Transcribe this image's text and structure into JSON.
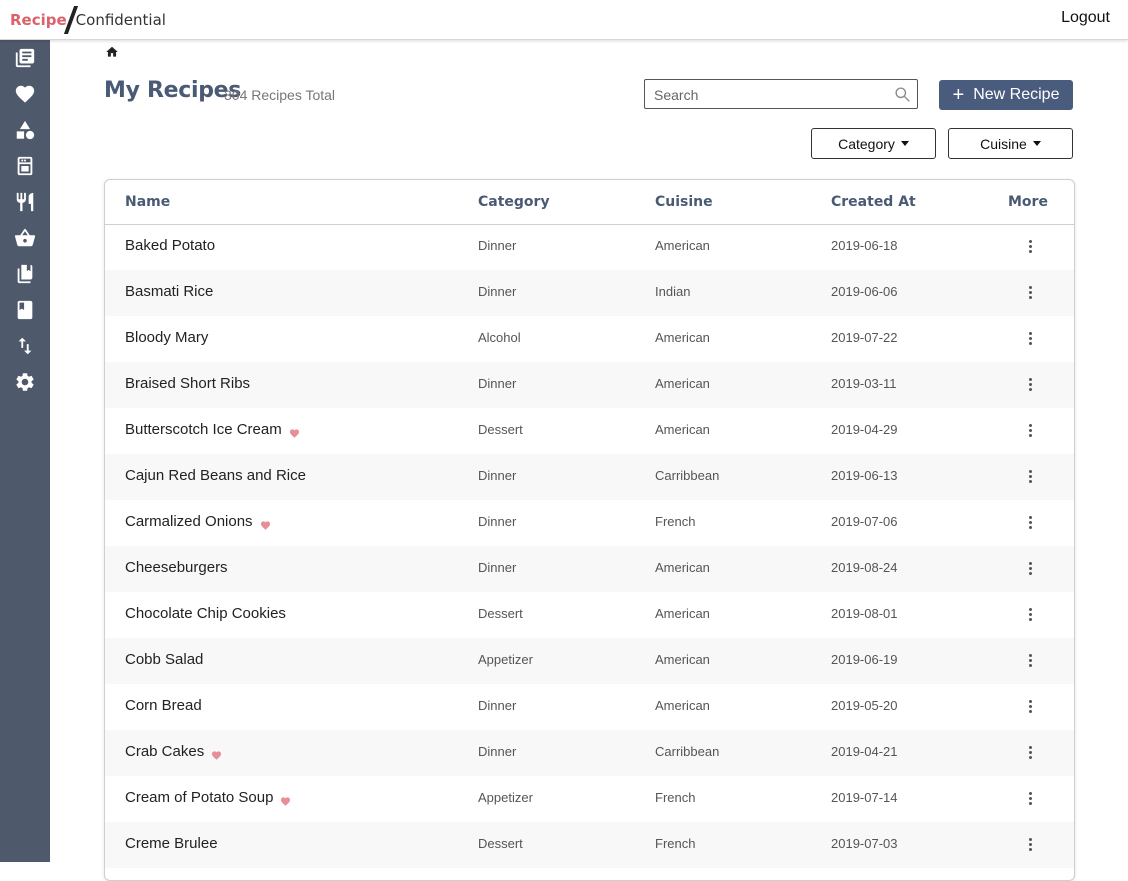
{
  "app": {
    "logo_part1": "Recipe",
    "logo_part2": "Confidential",
    "logout_label": "Logout"
  },
  "sidebar": {
    "icons": [
      "recipes-list-icon",
      "favorites-heart-icon",
      "categories-shapes-icon",
      "appliance-icon",
      "utensils-icon",
      "grocery-basket-icon",
      "cookbooks-icon",
      "book-icon",
      "import-export-icon",
      "settings-gear-icon"
    ]
  },
  "page": {
    "title": "My Recipes",
    "subtitle": "304 Recipes Total"
  },
  "search": {
    "placeholder": "Search",
    "value": ""
  },
  "new_recipe_label": "New Recipe",
  "filters": {
    "category_label": "Category",
    "cuisine_label": "Cuisine"
  },
  "table": {
    "headers": {
      "name": "Name",
      "category": "Category",
      "cuisine": "Cuisine",
      "created_at": "Created At",
      "more": "More"
    },
    "rows": [
      {
        "name": "Baked Potato",
        "favorite": false,
        "category": "Dinner",
        "cuisine": "American",
        "created_at": "2019-06-18"
      },
      {
        "name": "Basmati Rice",
        "favorite": false,
        "category": "Dinner",
        "cuisine": "Indian",
        "created_at": "2019-06-06"
      },
      {
        "name": "Bloody Mary",
        "favorite": false,
        "category": "Alcohol",
        "cuisine": "American",
        "created_at": "2019-07-22"
      },
      {
        "name": "Braised Short Ribs",
        "favorite": false,
        "category": "Dinner",
        "cuisine": "American",
        "created_at": "2019-03-11"
      },
      {
        "name": "Butterscotch Ice Cream",
        "favorite": true,
        "category": "Dessert",
        "cuisine": "American",
        "created_at": "2019-04-29"
      },
      {
        "name": "Cajun Red Beans and Rice",
        "favorite": false,
        "category": "Dinner",
        "cuisine": "Carribbean",
        "created_at": "2019-06-13"
      },
      {
        "name": "Carmalized Onions",
        "favorite": true,
        "category": "Dinner",
        "cuisine": "French",
        "created_at": "2019-07-06"
      },
      {
        "name": "Cheeseburgers",
        "favorite": false,
        "category": "Dinner",
        "cuisine": "American",
        "created_at": "2019-08-24"
      },
      {
        "name": "Chocolate Chip Cookies",
        "favorite": false,
        "category": "Dessert",
        "cuisine": "American",
        "created_at": "2019-08-01"
      },
      {
        "name": "Cobb Salad",
        "favorite": false,
        "category": "Appetizer",
        "cuisine": "American",
        "created_at": "2019-06-19"
      },
      {
        "name": "Corn Bread",
        "favorite": false,
        "category": "Dinner",
        "cuisine": "American",
        "created_at": "2019-05-20"
      },
      {
        "name": "Crab Cakes",
        "favorite": true,
        "category": "Dinner",
        "cuisine": "Carribbean",
        "created_at": "2019-04-21"
      },
      {
        "name": "Cream of Potato Soup",
        "favorite": true,
        "category": "Appetizer",
        "cuisine": "French",
        "created_at": "2019-07-14"
      },
      {
        "name": "Creme Brulee",
        "favorite": false,
        "category": "Dessert",
        "cuisine": "French",
        "created_at": "2019-07-03"
      }
    ]
  },
  "colors": {
    "sidebar": "#4e5a6b",
    "accent": "#4a5c7d",
    "heading": "#4a5a74",
    "favorite": "#e88e97",
    "logo_red": "#d9626b"
  }
}
